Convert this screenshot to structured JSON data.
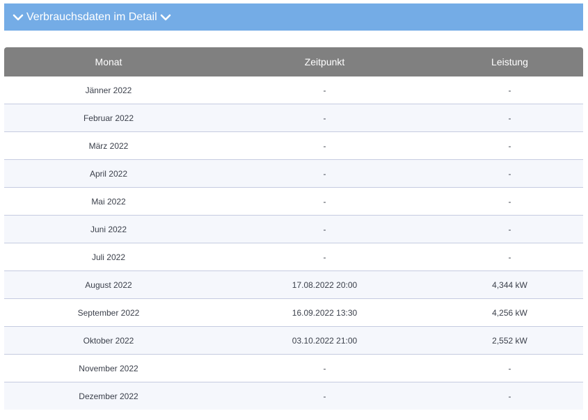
{
  "accordion": {
    "title": "Verbrauchsdaten im Detail",
    "leading_icon": "chevron-down-icon",
    "trailing_icon": "chevron-down-icon",
    "background_color": "#74ace6"
  },
  "table": {
    "header_color": "#808080",
    "columns": [
      "Monat",
      "Zeitpunkt",
      "Leistung"
    ],
    "rows": [
      {
        "month": "Jänner 2022",
        "time": "-",
        "power": "-"
      },
      {
        "month": "Februar 2022",
        "time": "-",
        "power": "-"
      },
      {
        "month": "März 2022",
        "time": "-",
        "power": "-"
      },
      {
        "month": "April 2022",
        "time": "-",
        "power": "-"
      },
      {
        "month": "Mai 2022",
        "time": "-",
        "power": "-"
      },
      {
        "month": "Juni 2022",
        "time": "-",
        "power": "-"
      },
      {
        "month": "Juli 2022",
        "time": "-",
        "power": "-"
      },
      {
        "month": "August 2022",
        "time": "17.08.2022 20:00",
        "power": "4,344 kW"
      },
      {
        "month": "September 2022",
        "time": "16.09.2022 13:30",
        "power": "4,256 kW"
      },
      {
        "month": "Oktober 2022",
        "time": "03.10.2022 21:00",
        "power": "2,552 kW"
      },
      {
        "month": "November 2022",
        "time": "-",
        "power": "-"
      },
      {
        "month": "Dezember 2022",
        "time": "-",
        "power": "-"
      }
    ]
  }
}
